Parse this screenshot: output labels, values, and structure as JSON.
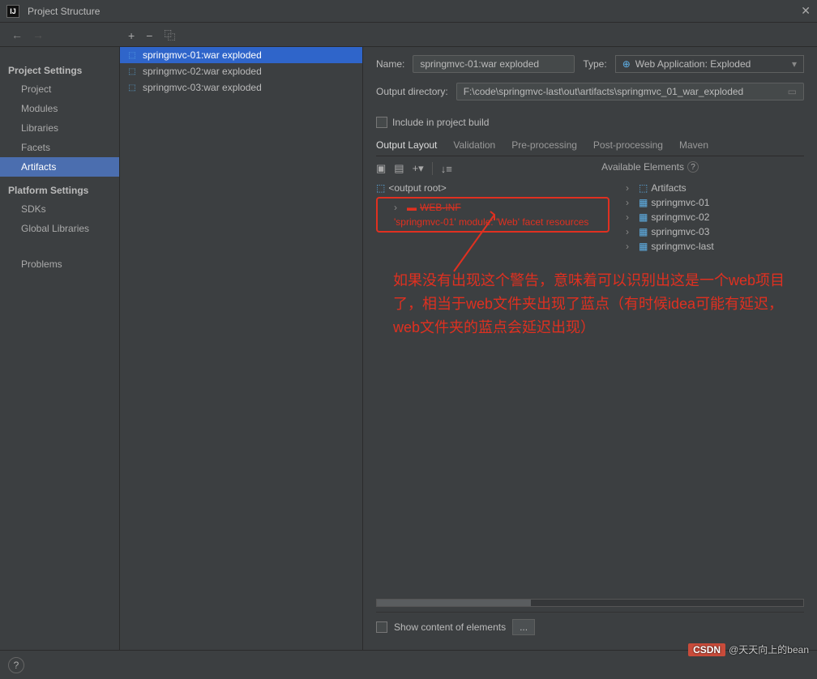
{
  "window": {
    "title": "Project Structure"
  },
  "sidebar": {
    "project_settings_label": "Project Settings",
    "project_items": [
      "Project",
      "Modules",
      "Libraries",
      "Facets",
      "Artifacts"
    ],
    "platform_settings_label": "Platform Settings",
    "platform_items": [
      "SDKs",
      "Global Libraries"
    ],
    "problems_label": "Problems",
    "selected": "Artifacts"
  },
  "toolbar": {
    "plus": "+",
    "minus": "−",
    "copy": "⿻"
  },
  "artifacts": {
    "items": [
      "springmvc-01:war exploded",
      "springmvc-02:war exploded",
      "springmvc-03:war exploded"
    ],
    "selected_index": 0
  },
  "details": {
    "name_label": "Name:",
    "name_value": "springmvc-01:war exploded",
    "type_label": "Type:",
    "type_value": "Web Application: Exploded",
    "output_dir_label": "Output directory:",
    "output_dir_value": "F:\\code\\springmvc-last\\out\\artifacts\\springmvc_01_war_exploded",
    "include_label": "Include in project build",
    "tabs": [
      "Output Layout",
      "Validation",
      "Pre-processing",
      "Post-processing",
      "Maven"
    ],
    "active_tab": 0,
    "show_content_label": "Show content of elements",
    "dots": "..."
  },
  "output_tree": {
    "root_label": "<output root>",
    "webinf_label": "WEB-INF",
    "warning_text": "'springmvc-01' module: 'Web' facet resources"
  },
  "available": {
    "header": "Available Elements",
    "help_icon": "?",
    "artifacts_label": "Artifacts",
    "modules": [
      "springmvc-01",
      "springmvc-02",
      "springmvc-03",
      "springmvc-last"
    ]
  },
  "annotation": {
    "text": "如果没有出现这个警告，意味着可以识别出这是一个web项目了，相当于web文件夹出现了蓝点（有时候idea可能有延迟，web文件夹的蓝点会延迟出现）"
  },
  "watermark": {
    "csdn": "CSDN",
    "author": "@天天向上的bean"
  }
}
